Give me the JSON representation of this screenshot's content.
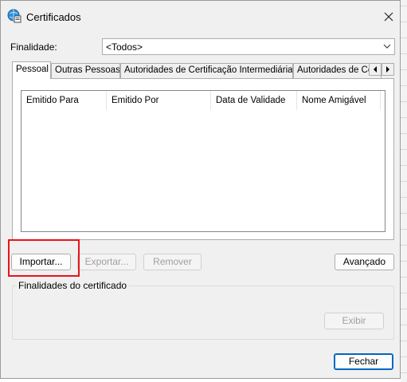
{
  "window": {
    "title": "Certificados",
    "icon": "certificate-icon",
    "close_icon": "close-icon"
  },
  "filter": {
    "label": "Finalidade:",
    "selected": "<Todos>"
  },
  "tabs": [
    {
      "label": "Pessoal",
      "active": true
    },
    {
      "label": "Outras Pessoas",
      "active": false
    },
    {
      "label": "Autoridades de Certificação Intermediárias",
      "active": false
    },
    {
      "label": "Autoridades de Ce",
      "active": false
    }
  ],
  "table": {
    "columns": [
      "Emitido Para",
      "Emitido Por",
      "Data de Validade",
      "Nome Amigável"
    ],
    "rows": []
  },
  "actions": {
    "import_label": "Importar...",
    "export_label": "Exportar...",
    "remove_label": "Remover",
    "advanced_label": "Avançado"
  },
  "purposes": {
    "title": "Finalidades do certificado",
    "view_label": "Exibir"
  },
  "footer": {
    "close_label": "Fechar"
  },
  "colors": {
    "highlight": "#e8141b",
    "default_button_border": "#0067c0"
  }
}
